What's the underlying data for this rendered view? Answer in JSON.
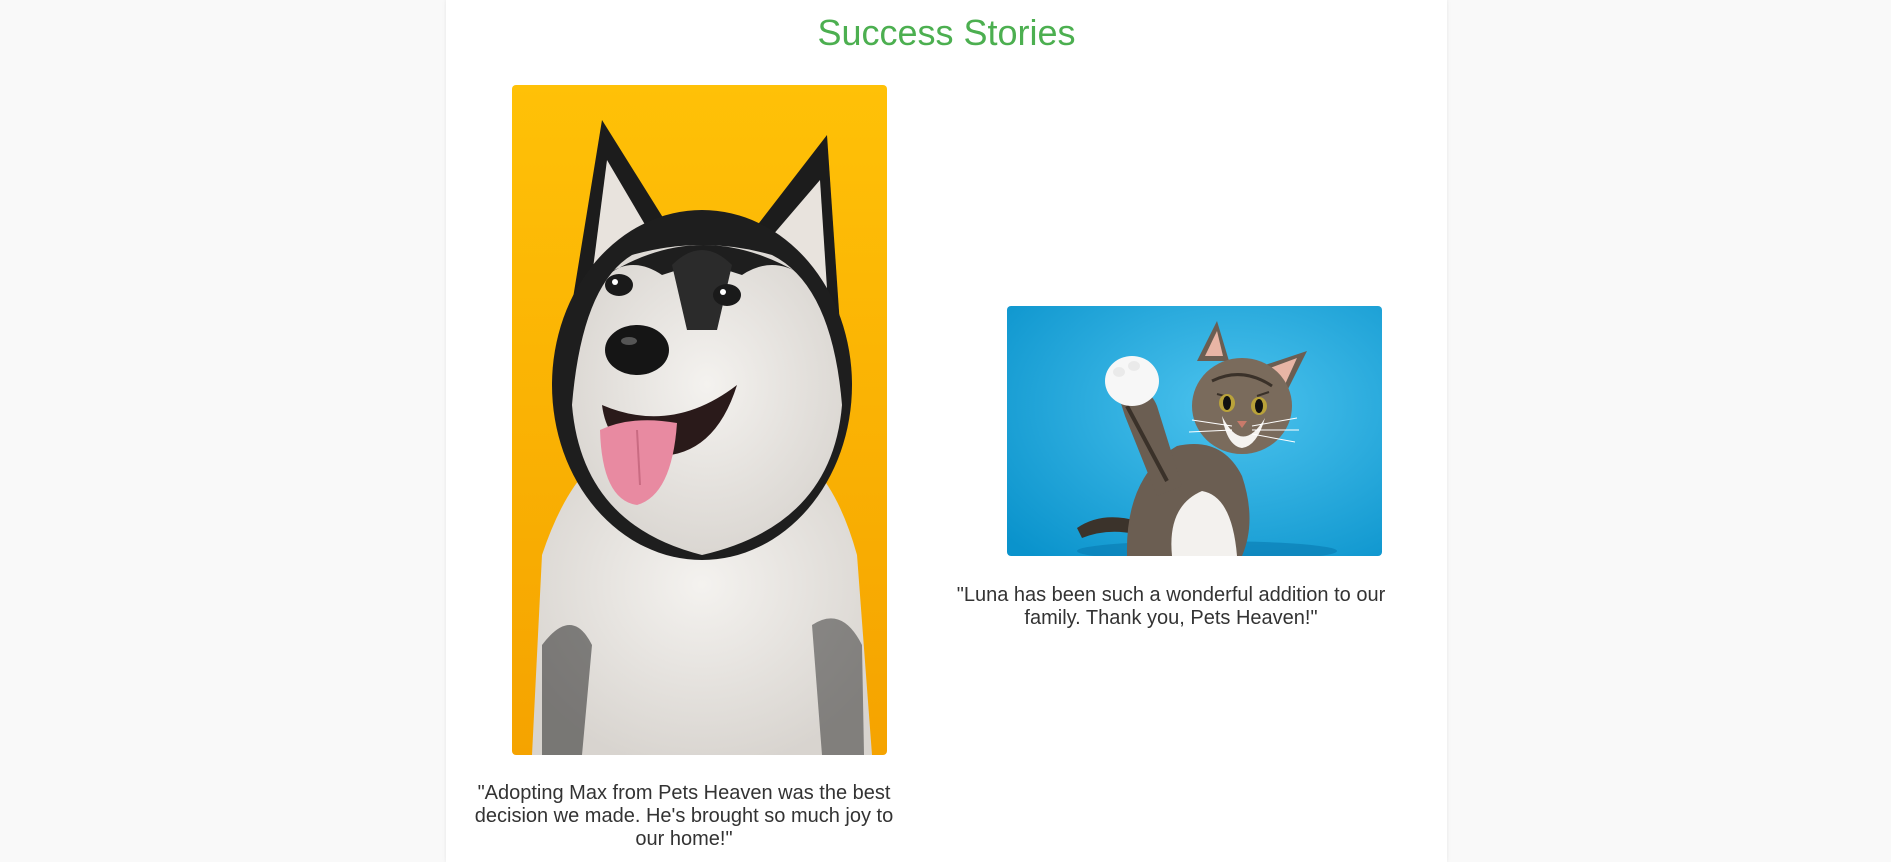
{
  "page": {
    "title": "Success Stories",
    "accent_color": "#4caf50",
    "panel_background": "#ffffff",
    "page_background": "#f9f9f9"
  },
  "stories": [
    {
      "image": "husky-dog-photo",
      "quote": "\"Adopting Max from Pets Heaven was the best decision we made. He's brought so much joy to our home!\""
    },
    {
      "image": "tabby-cat-waving-photo",
      "quote": "\"Luna has been such a wonderful addition to our family. Thank you, Pets Heaven!\""
    }
  ]
}
